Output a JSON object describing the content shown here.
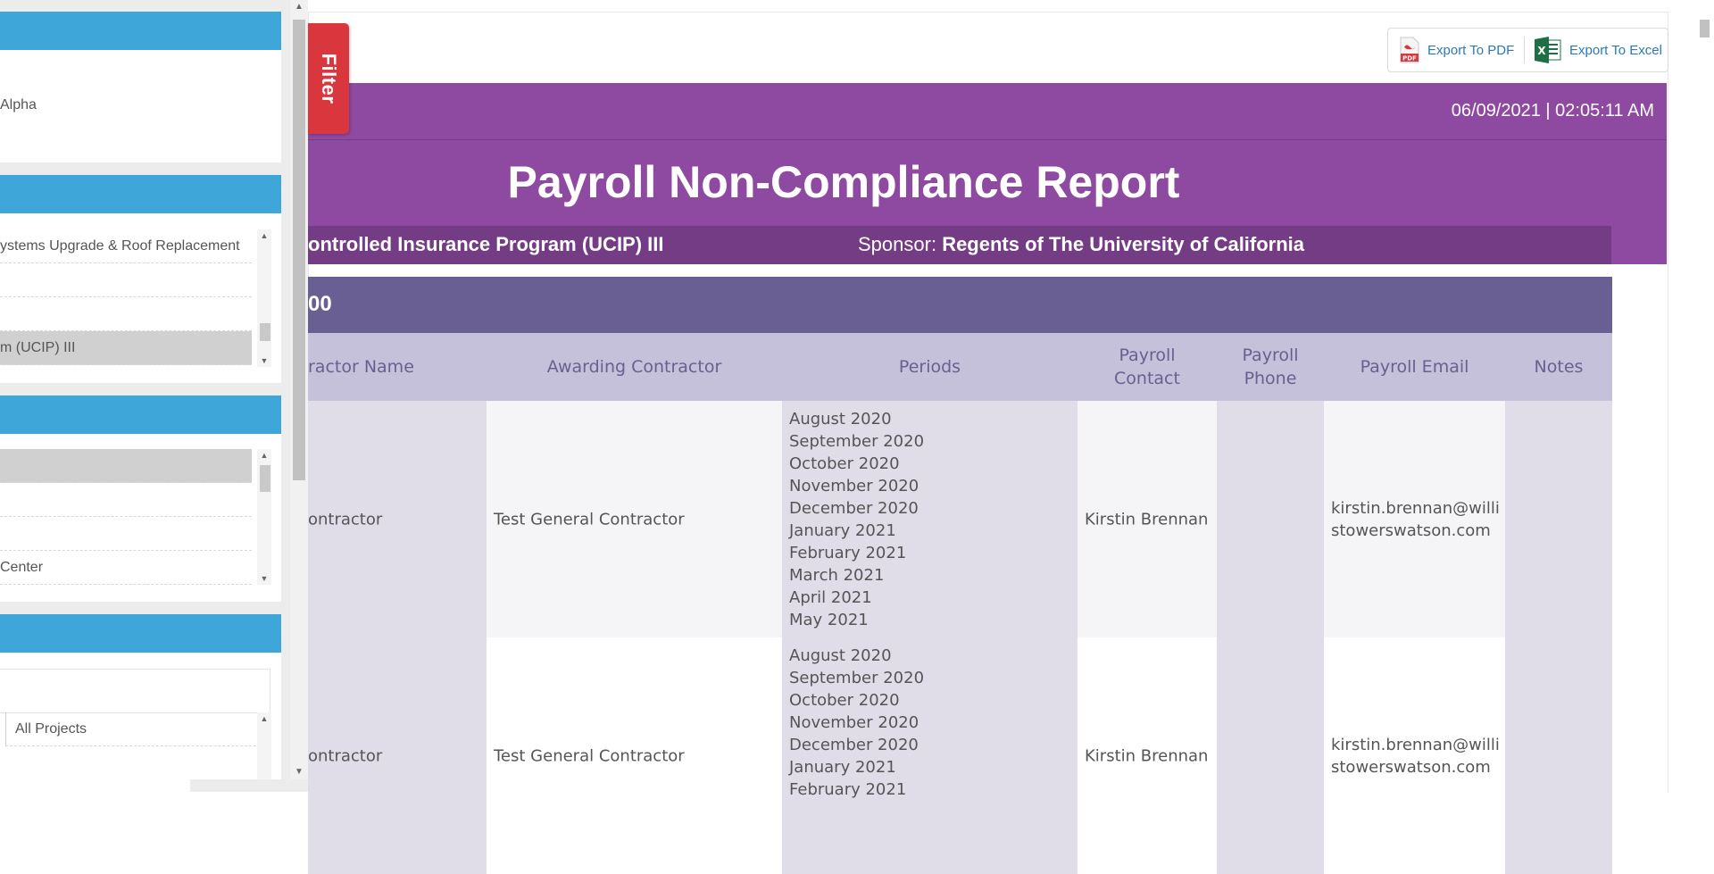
{
  "filter_panel": {
    "section1": {
      "value": "Alpha"
    },
    "section2": {
      "items": [
        "ystems Upgrade & Roof Replacement",
        "",
        "",
        "m (UCIP) III"
      ]
    },
    "section3": {
      "items": [
        "",
        "",
        "",
        "Center"
      ]
    },
    "section4": {
      "items": [
        "All Projects"
      ]
    }
  },
  "filter_tab": {
    "label": "Filter"
  },
  "export": {
    "pdf_label": "Export To PDF",
    "excel_label": "Export To Excel"
  },
  "report": {
    "datetime": "06/09/2021 | 02:05:11 AM",
    "title": "Payroll Non-Compliance Report",
    "program": "ontrolled Insurance Program (UCIP) III",
    "sponsor_label": "Sponsor:",
    "sponsor_value": "Regents of The University of California",
    "group_label": "00"
  },
  "table": {
    "columns": [
      "ractor Name",
      "Awarding Contractor",
      "Periods",
      "Payroll Contact",
      "Payroll Phone",
      "Payroll Email",
      "Notes"
    ],
    "rows": [
      {
        "contractor": "ontractor",
        "awarding": "Test General Contractor",
        "periods": [
          "August 2020",
          "September 2020",
          "October 2020",
          "November 2020",
          "December 2020",
          "January 2021",
          "February 2021",
          "March 2021",
          "April 2021",
          "May 2021"
        ],
        "contact": "Kirstin Brennan",
        "phone": "",
        "email": "kirstin.brennan@willistowerswatson.com",
        "notes": ""
      },
      {
        "contractor": "ontractor",
        "awarding": "Test General Contractor",
        "periods": [
          "August 2020",
          "September 2020",
          "October 2020",
          "November 2020",
          "December 2020",
          "January 2021",
          "February 2021"
        ],
        "contact": "Kirstin Brennan",
        "phone": "",
        "email": "kirstin.brennan@willistowerswatson.com",
        "notes": ""
      }
    ]
  },
  "colors": {
    "panel_header": "#3fa6d9",
    "filter_tab": "#d9363e",
    "report_header": "#8e4aa0",
    "program_band": "#733c84",
    "group_band": "#695f93",
    "table_header": "#c5c1da",
    "link": "#2a7ab8"
  }
}
